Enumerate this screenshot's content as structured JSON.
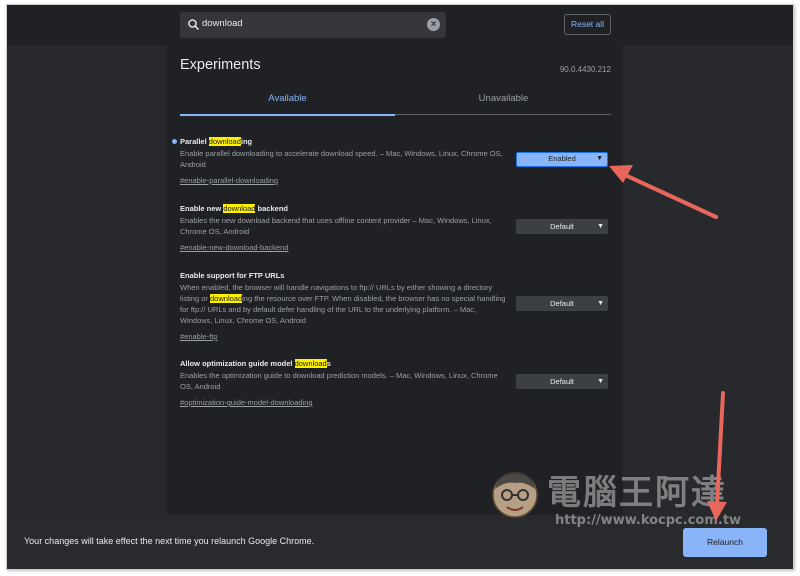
{
  "search": {
    "query": "download",
    "clear_icon": "clear-icon",
    "search_icon": "search-icon"
  },
  "toolbar": {
    "reset_label": "Reset all"
  },
  "page": {
    "title": "Experiments",
    "version": "90.0.4430.212"
  },
  "tabs": [
    {
      "label": "Available",
      "active": true
    },
    {
      "label": "Unavailable",
      "active": false
    }
  ],
  "experiments": [
    {
      "name_pre": "Parallel ",
      "name_hl": "download",
      "name_post": "ing",
      "desc_pre": "Enable parallel downloading to accelerate download speed. – Mac, Windows, Linux, Chrome OS, Android",
      "desc_hl": "",
      "desc_post": "",
      "link": "#enable-parallel-downloading",
      "value": "Enabled",
      "modified": true
    },
    {
      "name_pre": "Enable new ",
      "name_hl": "download",
      "name_post": " backend",
      "desc_pre": "Enables the new download backend that uses offline content provider – Mac, Windows, Linux, Chrome OS, Android",
      "desc_hl": "",
      "desc_post": "",
      "link": "#enable-new-download-backend",
      "value": "Default",
      "modified": false
    },
    {
      "name_pre": "Enable support for FTP URLs",
      "name_hl": "",
      "name_post": "",
      "desc_pre": "When enabled, the browser will handle navigations to ftp:// URLs by either showing a directory listing or ",
      "desc_hl": "download",
      "desc_post": "ing the resource over FTP. When disabled, the browser has no special handling for ftp:// URLs and by default defer handling of the URL to the underlying platform. – Mac, Windows, Linux, Chrome OS, Android",
      "link": "#enable-ftp",
      "value": "Default",
      "modified": false
    },
    {
      "name_pre": "Allow optimization guide model ",
      "name_hl": "download",
      "name_post": "s",
      "desc_pre": "Enables the optimization guide to download prediction models. – Mac, Windows, Linux, Chrome OS, Android",
      "desc_hl": "",
      "desc_post": "",
      "link": "#optimization-guide-model-downloading",
      "value": "Default",
      "modified": false
    }
  ],
  "footer": {
    "notice": "Your changes will take effect the next time you relaunch Google Chrome.",
    "relaunch_label": "Relaunch"
  },
  "watermark": {
    "text": "電腦王阿達",
    "url": "http://www.kocpc.com.tw"
  },
  "colors": {
    "accent": "#8ab4f8",
    "background": "#202124",
    "highlight": "#fdf100",
    "arrow": "#e8675c"
  }
}
